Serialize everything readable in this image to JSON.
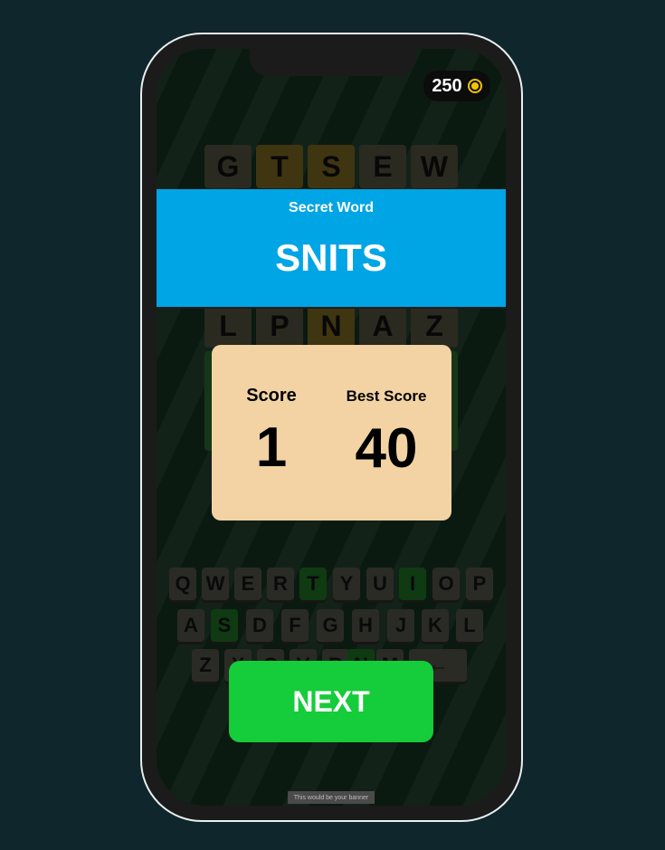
{
  "coins": {
    "value": "250",
    "icon": "coin-icon",
    "color": "#f2c400"
  },
  "board": {
    "row1": [
      "G",
      "T",
      "S",
      "E",
      "W"
    ],
    "row2": [
      "L",
      "P",
      "N",
      "A",
      "Z"
    ]
  },
  "secret": {
    "label": "Secret Word",
    "word": "SNITS",
    "color": "#00a5e6"
  },
  "score": {
    "score_label": "Score",
    "score_value": "1",
    "best_label": "Best Score",
    "best_value": "40"
  },
  "keyboard": {
    "row1": [
      "Q",
      "W",
      "E",
      "R",
      "T",
      "Y",
      "U",
      "I",
      "O",
      "P"
    ],
    "row2": [
      "A",
      "S",
      "D",
      "F",
      "G",
      "H",
      "J",
      "K",
      "L"
    ],
    "row3": [
      "Z",
      "X",
      "C",
      "V",
      "B",
      "N",
      "M"
    ],
    "backspace": "←"
  },
  "next_button": {
    "label": "NEXT",
    "color": "#15cc3a"
  },
  "ad": {
    "text": "This would be your banner"
  }
}
